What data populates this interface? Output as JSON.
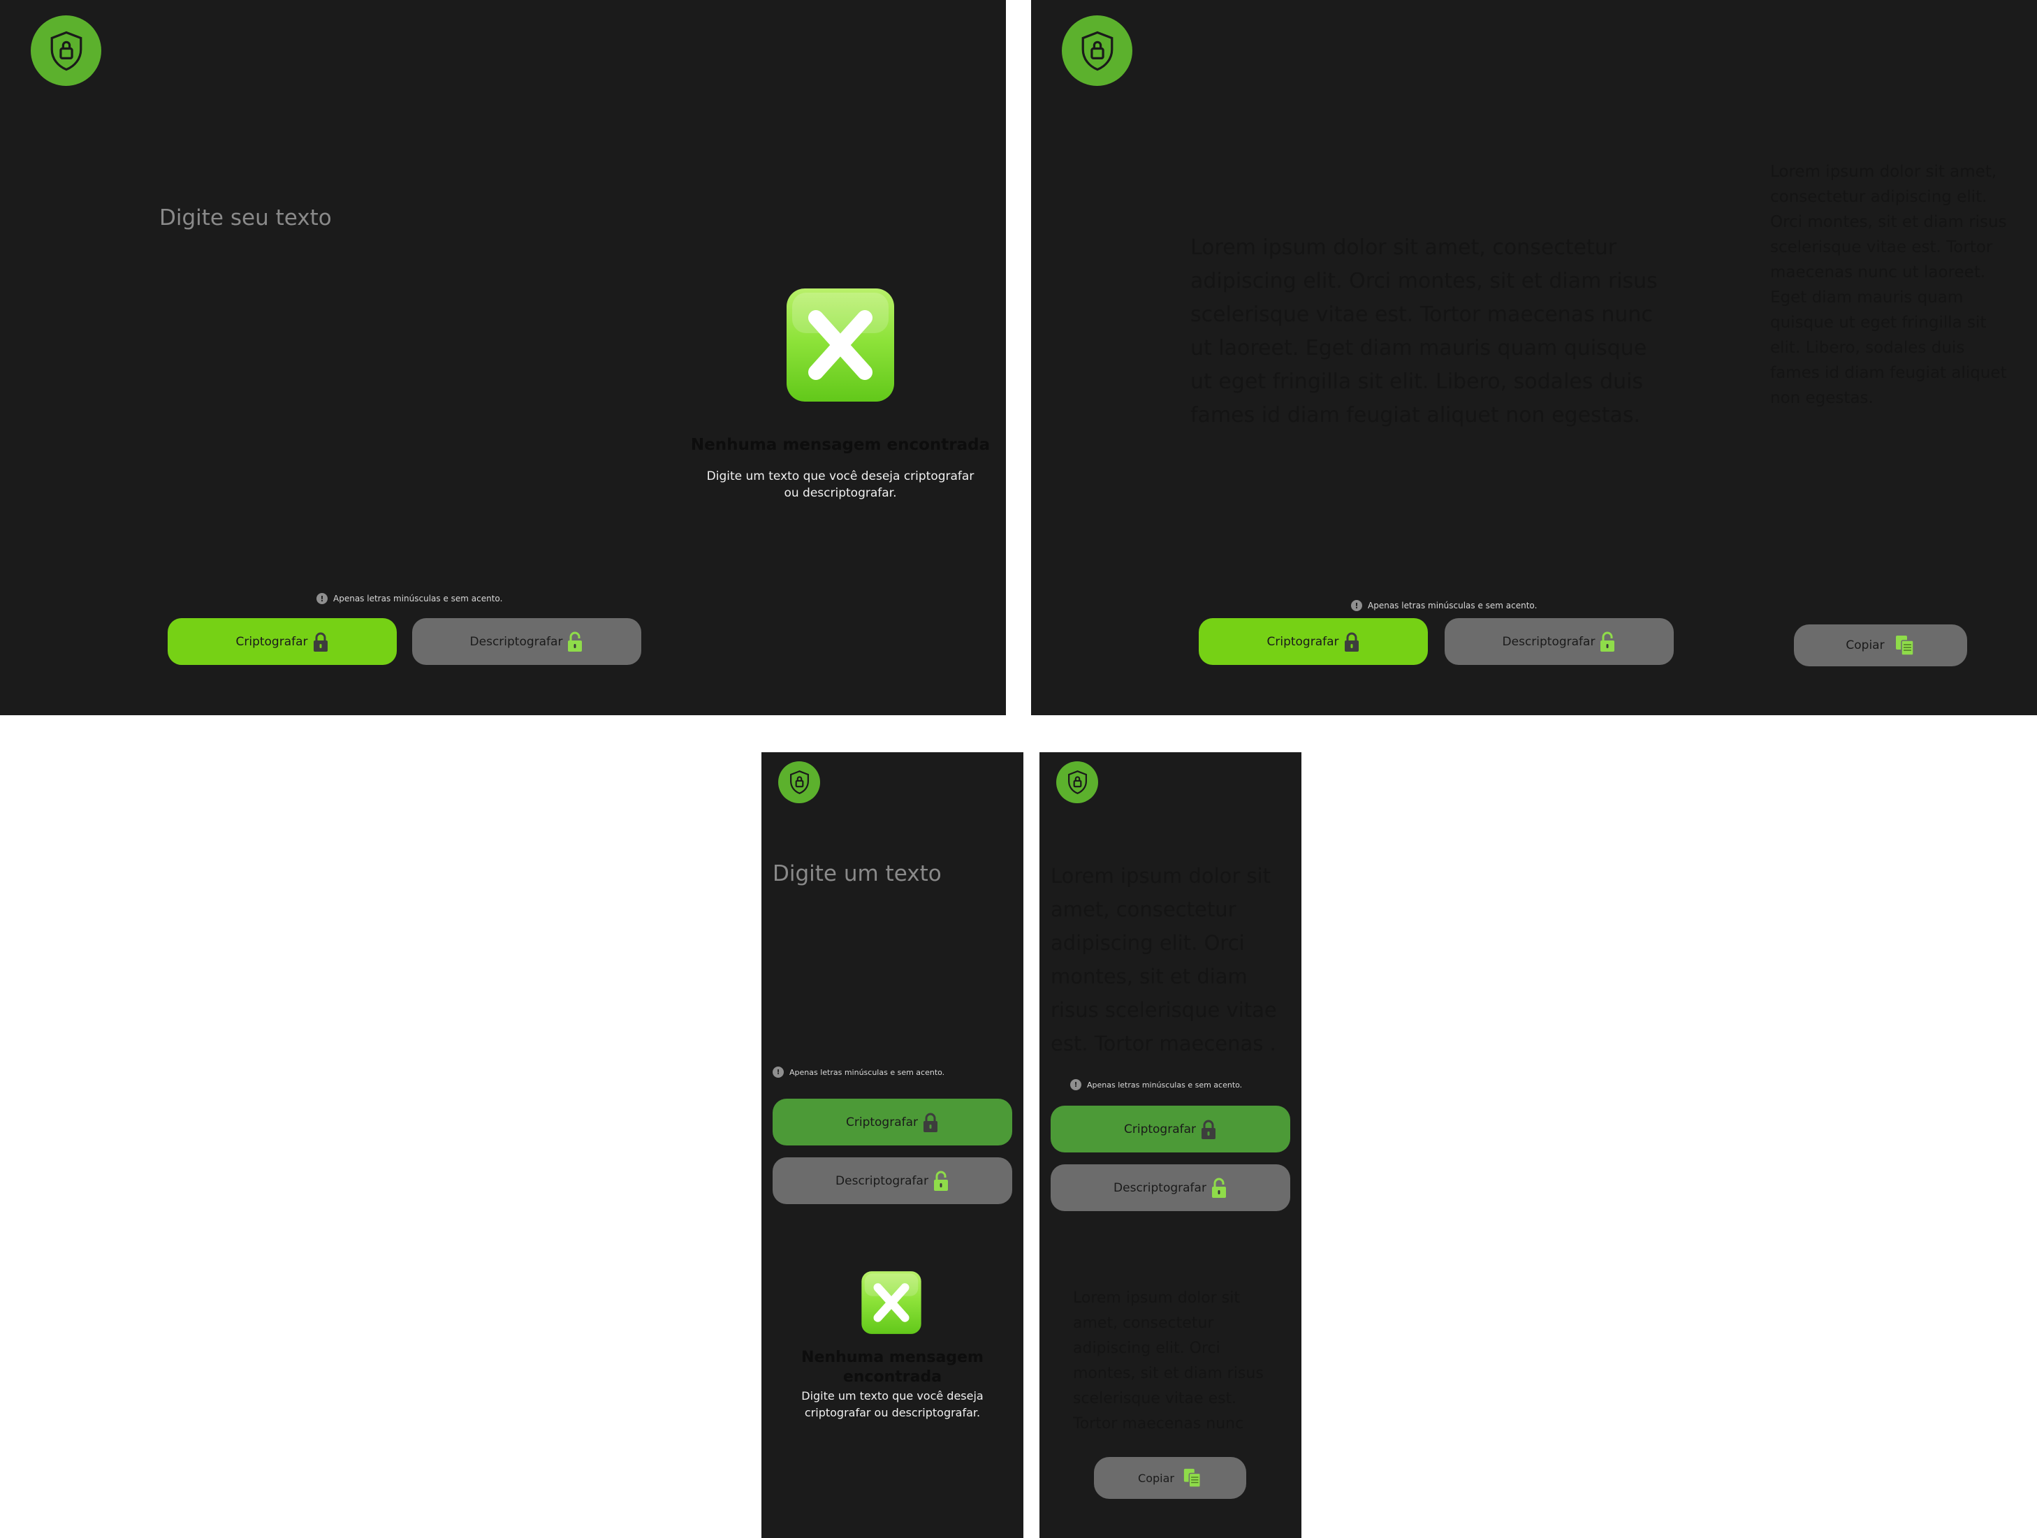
{
  "colors": {
    "background": "#1b1b1b",
    "accent_green": "#76d115",
    "logo_green": "#5cb12d",
    "button_gray": "#6c6c6c",
    "placeholder_text": "#8a8a8a"
  },
  "icons": {
    "logo": "shield-lock-icon",
    "encrypt": "lock-closed-icon",
    "decrypt": "lock-open-icon",
    "copy": "copy-documents-icon",
    "empty_state": "x-mark-icon",
    "hint": "info-icon"
  },
  "desktop_empty": {
    "input_placeholder": "Digite seu texto",
    "hint": "Apenas letras minúsculas e sem acento.",
    "encrypt_label": "Criptografar",
    "decrypt_label": "Descriptografar",
    "empty_title": "Nenhuma mensagem encontrada",
    "empty_subtitle": "Digite um texto que você deseja criptografar ou descriptografar."
  },
  "desktop_filled": {
    "input_text": "Lorem ipsum dolor sit amet, consectetur adipiscing elit. Orci montes, sit et diam risus scelerisque vitae est. Tortor maecenas nunc ut laoreet. Eget diam mauris quam quisque ut eget fringilla sit elit. Libero, sodales duis fames id diam feugiat aliquet non egestas.",
    "output_text": "Lorem ipsum dolor sit amet, consectetur adipiscing elit. Orci montes, sit et diam risus scelerisque vitae est. Tortor maecenas nunc ut laoreet. Eget diam mauris quam quisque ut eget fringilla sit elit. Libero, sodales duis fames id diam feugiat aliquet non egestas.",
    "hint": "Apenas letras minúsculas e sem acento.",
    "encrypt_label": "Criptografar",
    "decrypt_label": "Descriptografar",
    "copy_label": "Copiar"
  },
  "mobile_empty": {
    "input_placeholder": "Digite um texto",
    "hint": "Apenas letras minúsculas e sem acento.",
    "encrypt_label": "Criptografar",
    "decrypt_label": "Descriptografar",
    "empty_title": "Nenhuma mensagem encontrada",
    "empty_subtitle": "Digite um texto que você deseja criptografar ou descriptografar."
  },
  "mobile_filled": {
    "input_text": "Lorem ipsum dolor sit amet, consectetur adipiscing elit. Orci montes, sit et diam risus scelerisque vitae est. Tortor maecenas .",
    "output_text": "Lorem ipsum dolor sit amet, consectetur adipiscing elit. Orci montes, sit et diam risus scelerisque vitae est. Tortor maecenas nunc",
    "hint": "Apenas letras minúsculas e sem acento.",
    "encrypt_label": "Criptografar",
    "decrypt_label": "Descriptografar",
    "copy_label": "Copiar"
  }
}
